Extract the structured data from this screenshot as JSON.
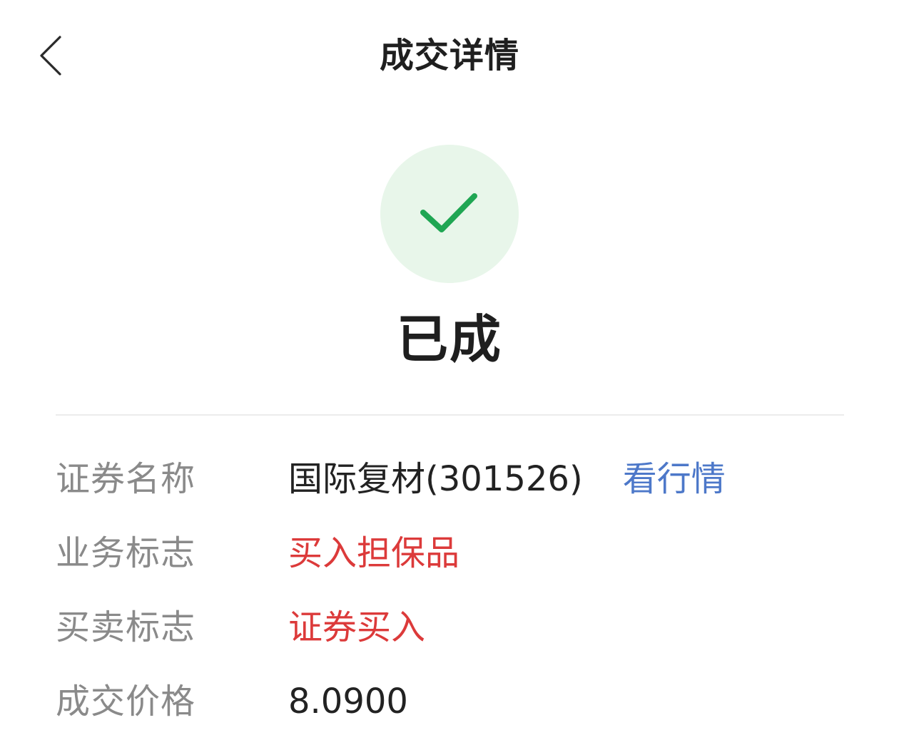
{
  "header": {
    "title": "成交详情",
    "back_icon": "chevron-left-icon"
  },
  "status": {
    "icon": "checkmark-icon",
    "text": "已成",
    "circle_color": "#e8f6ea",
    "check_color": "#1fa653"
  },
  "details": {
    "security": {
      "label": "证券名称",
      "value": "国际复材(301526)",
      "link_label": "看行情"
    },
    "business_flag": {
      "label": "业务标志",
      "value": "买入担保品",
      "color": "#dc3a3a"
    },
    "trade_flag": {
      "label": "买卖标志",
      "value": "证券买入",
      "color": "#dc3a3a"
    },
    "price": {
      "label": "成交价格",
      "value": "8.0900"
    }
  },
  "colors": {
    "link": "#4d78c9",
    "label": "#8a8a8a",
    "text": "#222222"
  }
}
